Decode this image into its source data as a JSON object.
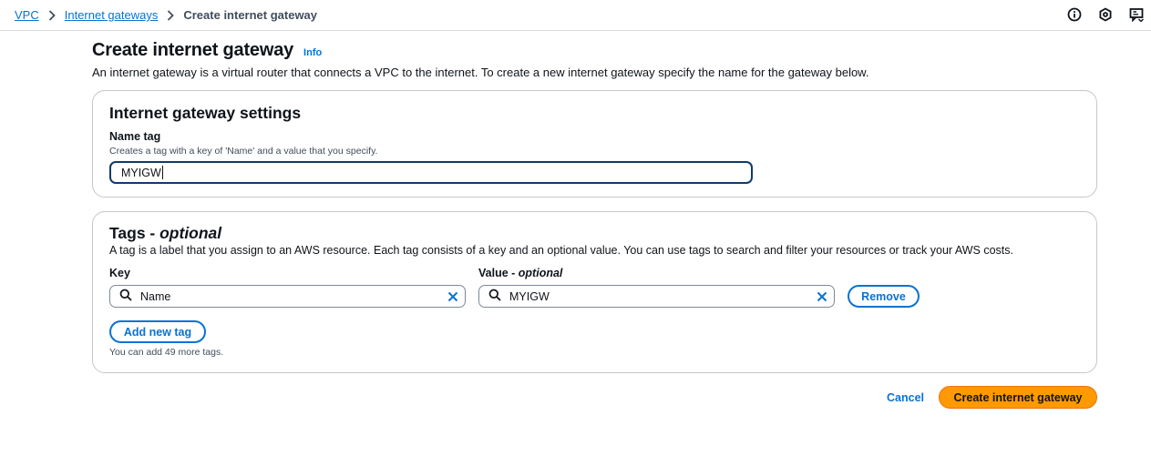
{
  "breadcrumb": {
    "items": [
      "VPC",
      "Internet gateways"
    ],
    "current": "Create internet gateway"
  },
  "top_icons": [
    "info-circle-icon",
    "settings-hexagon-icon",
    "feedback-icon"
  ],
  "header": {
    "title": "Create internet gateway",
    "info_label": "Info",
    "description": "An internet gateway is a virtual router that connects a VPC to the internet. To create a new internet gateway specify the name for the gateway below."
  },
  "settings": {
    "title": "Internet gateway settings",
    "name_tag_label": "Name tag",
    "name_tag_description": "Creates a tag with a key of 'Name' and a value that you specify.",
    "name_tag_value": "MYIGW"
  },
  "tags": {
    "title_main": "Tags - ",
    "title_optional": "optional",
    "description": "A tag is a label that you assign to an AWS resource. Each tag consists of a key and an optional value. You can use tags to search and filter your resources or track your AWS costs.",
    "key_label": "Key",
    "value_label_main": "Value - ",
    "value_label_optional": "optional",
    "rows": [
      {
        "key": "Name",
        "value": "MYIGW",
        "remove_label": "Remove"
      }
    ],
    "add_new_tag_label": "Add new tag",
    "limit_text": "You can add 49 more tags."
  },
  "actions": {
    "cancel_label": "Cancel",
    "create_label": "Create internet gateway"
  },
  "colors": {
    "link": "#0972d3",
    "primary_button": "#ff9900",
    "focus_border": "#0f3a6b",
    "text": "#0f141a"
  }
}
